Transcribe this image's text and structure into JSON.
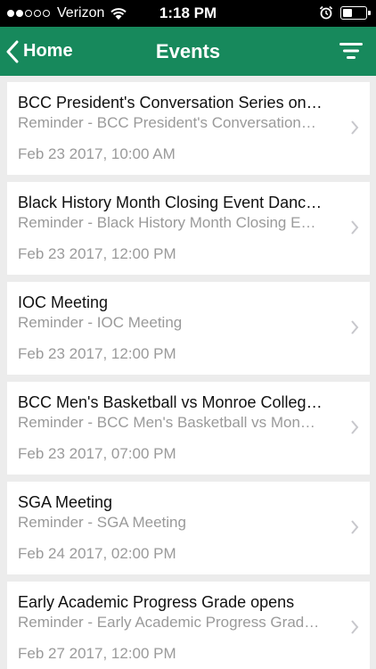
{
  "status_bar": {
    "carrier": "Verizon",
    "time": "1:18 PM",
    "signal_dots_filled": 2,
    "signal_dots_total": 5
  },
  "nav": {
    "back_label": "Home",
    "title": "Events",
    "accent_color": "#17895c"
  },
  "events": [
    {
      "title": "BCC President's Conversation Series on…",
      "subtitle": "Reminder - BCC President's Conversation…",
      "date": "Feb 23 2017, 10:00 AM"
    },
    {
      "title": "Black History Month Closing Event Danc…",
      "subtitle": "Reminder - Black History Month Closing E…",
      "date": "Feb 23 2017, 12:00 PM"
    },
    {
      "title": "IOC Meeting",
      "subtitle": "Reminder - IOC Meeting",
      "date": "Feb 23 2017, 12:00 PM"
    },
    {
      "title": "BCC Men's Basketball vs Monroe Colleg…",
      "subtitle": "Reminder - BCC Men's Basketball vs Mon…",
      "date": "Feb 23 2017, 07:00 PM"
    },
    {
      "title": "SGA Meeting",
      "subtitle": "Reminder - SGA Meeting",
      "date": "Feb 24 2017, 02:00 PM"
    },
    {
      "title": "Early Academic Progress Grade opens",
      "subtitle": "Reminder - Early Academic Progress Grad…",
      "date": "Feb 27 2017, 12:00 PM"
    }
  ]
}
